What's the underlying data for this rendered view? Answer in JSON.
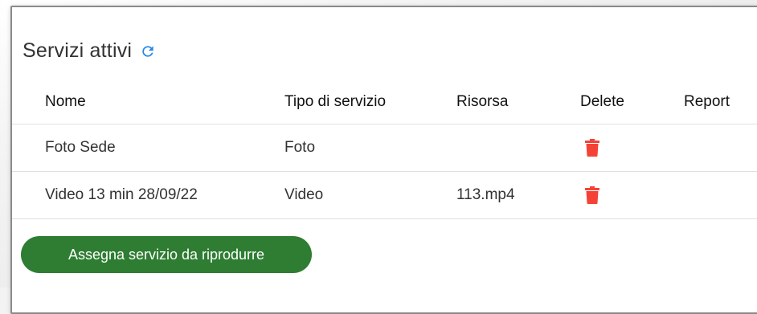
{
  "section": {
    "title": "Servizi attivi",
    "refresh_icon": "refresh-icon"
  },
  "table": {
    "columns": [
      "Nome",
      "Tipo di servizio",
      "Risorsa",
      "Delete",
      "Report"
    ],
    "rows": [
      {
        "nome": "Foto Sede",
        "tipo": "Foto",
        "risorsa": "",
        "delete_icon": "trash-icon",
        "report": ""
      },
      {
        "nome": "Video 13 min 28/09/22",
        "tipo": "Video",
        "risorsa": "113.mp4",
        "delete_icon": "trash-icon",
        "report": ""
      }
    ]
  },
  "actions": {
    "assign_label": "Assegna servizio da riprodurre"
  },
  "colors": {
    "accent_blue": "#1e88e5",
    "delete_red": "#f44336",
    "button_green": "#2e7d32"
  }
}
